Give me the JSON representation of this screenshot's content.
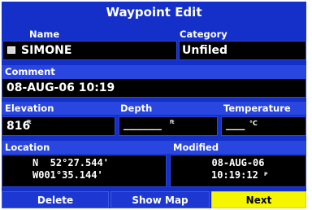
{
  "title": "Waypoint Edit",
  "labels": {
    "name": "Name",
    "category": "Category",
    "comment": "Comment",
    "elevation": "Elevation",
    "depth": "Depth",
    "temperature": "Temperature",
    "location": "Location",
    "modified": "Modified"
  },
  "fields": {
    "name": "SIMONE",
    "category": "Unfiled",
    "comment": "08-AUG-06 10:19",
    "elevation": "816",
    "elevation_unit": "ft",
    "depth": "______",
    "depth_unit": "ft",
    "temperature": "___",
    "temperature_unit": "°C",
    "location_lat": "N  52°27.544'",
    "location_lon": "W001°35.144'",
    "modified_date": "08-AUG-06",
    "modified_time": "10:19:12",
    "modified_time_suffix": "P"
  },
  "buttons": {
    "delete": "Delete",
    "show_map": "Show Map",
    "next": "Next"
  },
  "icons": {
    "waypoint_symbol": "waypoint-symbol-icon"
  },
  "colors": {
    "background": "#1530c8",
    "field": "#000000",
    "highlight": "#f5f500"
  }
}
